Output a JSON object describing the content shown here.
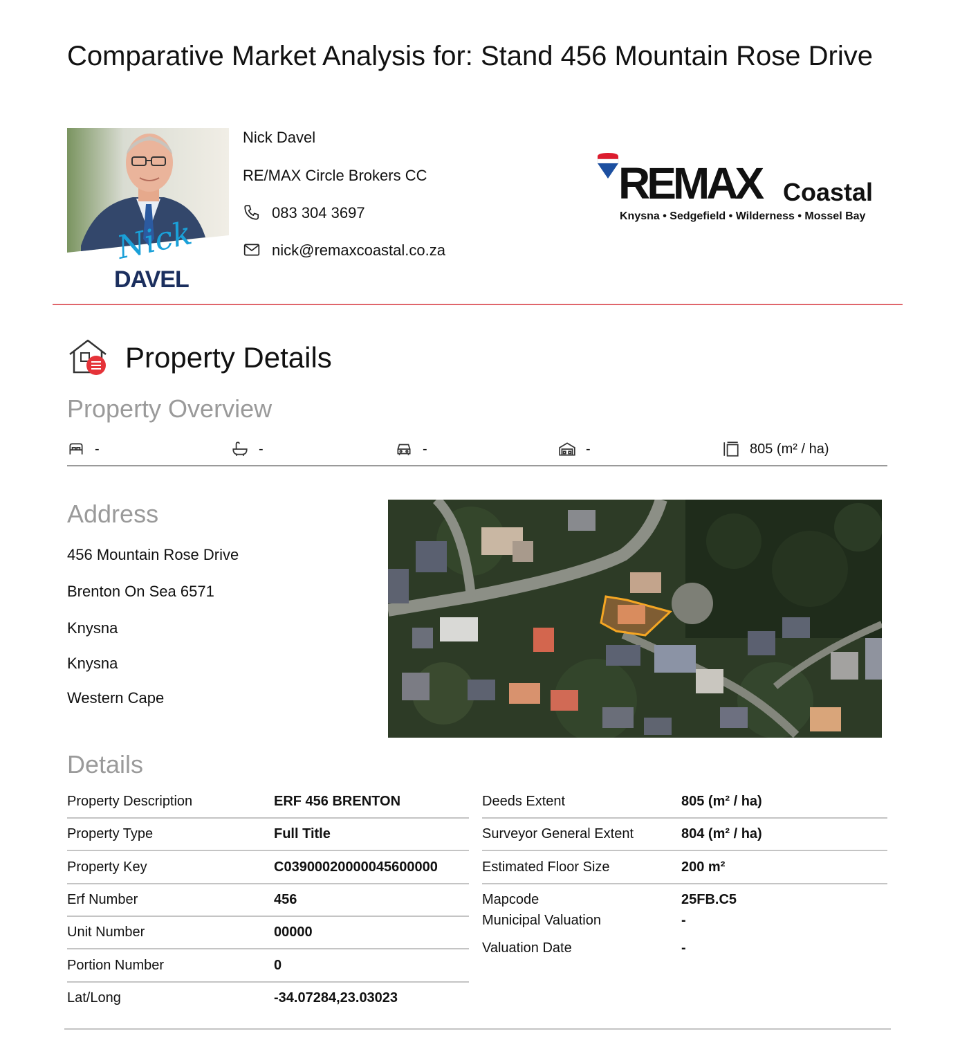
{
  "header": {
    "title": "Comparative Market Analysis for: Stand 456 Mountain Rose Drive"
  },
  "agent": {
    "name": "Nick Davel",
    "company": "RE/MAX Circle Brokers CC",
    "phone": "083 304 3697",
    "email": "nick@remaxcoastal.co.za",
    "signature": "Nick",
    "surname_banner": "DAVEL"
  },
  "logo": {
    "brand": "REMAX",
    "region": "Coastal",
    "tagline": "Knysna • Sedgefield • Wilderness • Mossel Bay",
    "colors": {
      "red": "#dc1c2e",
      "blue": "#1c4fa0",
      "text": "#111111"
    }
  },
  "property_details": {
    "heading": "Property Details",
    "icon": "house-list-icon",
    "overview": {
      "heading": "Property Overview",
      "items": [
        {
          "icon": "bed-icon",
          "value": "-"
        },
        {
          "icon": "bath-icon",
          "value": "-"
        },
        {
          "icon": "car-icon",
          "value": "-"
        },
        {
          "icon": "garage-icon",
          "value": "-"
        },
        {
          "icon": "area-icon",
          "value": "805 (m² / ha)"
        }
      ]
    },
    "address": {
      "heading": "Address",
      "lines": [
        "456 Mountain Rose Drive",
        "Brenton On Sea 6571",
        "Knysna",
        "Knysna",
        "Western Cape"
      ]
    },
    "details": {
      "heading": "Details",
      "left": [
        {
          "label": "Property Description",
          "value": "ERF 456 BRENTON"
        },
        {
          "label": "Property Type",
          "value": "Full Title"
        },
        {
          "label": "Property Key",
          "value": "C03900020000045600000"
        },
        {
          "label": "Erf Number",
          "value": "456"
        },
        {
          "label": "Unit Number",
          "value": "00000"
        },
        {
          "label": "Portion Number",
          "value": "0"
        },
        {
          "label": "Lat/Long",
          "value": "-34.07284,23.03023"
        }
      ],
      "right": [
        {
          "label": "Deeds Extent",
          "value": "805 (m² / ha)"
        },
        {
          "label": "Surveyor General Extent",
          "value": "804 (m² / ha)"
        },
        {
          "label": "Estimated Floor Size",
          "value": "200 m²"
        },
        {
          "label": "Mapcode",
          "value": "25FB.C5"
        },
        {
          "label": "Municipal Valuation",
          "value": "-"
        },
        {
          "label": "Valuation Date",
          "value": "-"
        }
      ]
    }
  },
  "colors": {
    "accent_rule": "#e0666b",
    "muted_heading": "#9a9a9a",
    "parcel_outline": "#f5a623"
  }
}
